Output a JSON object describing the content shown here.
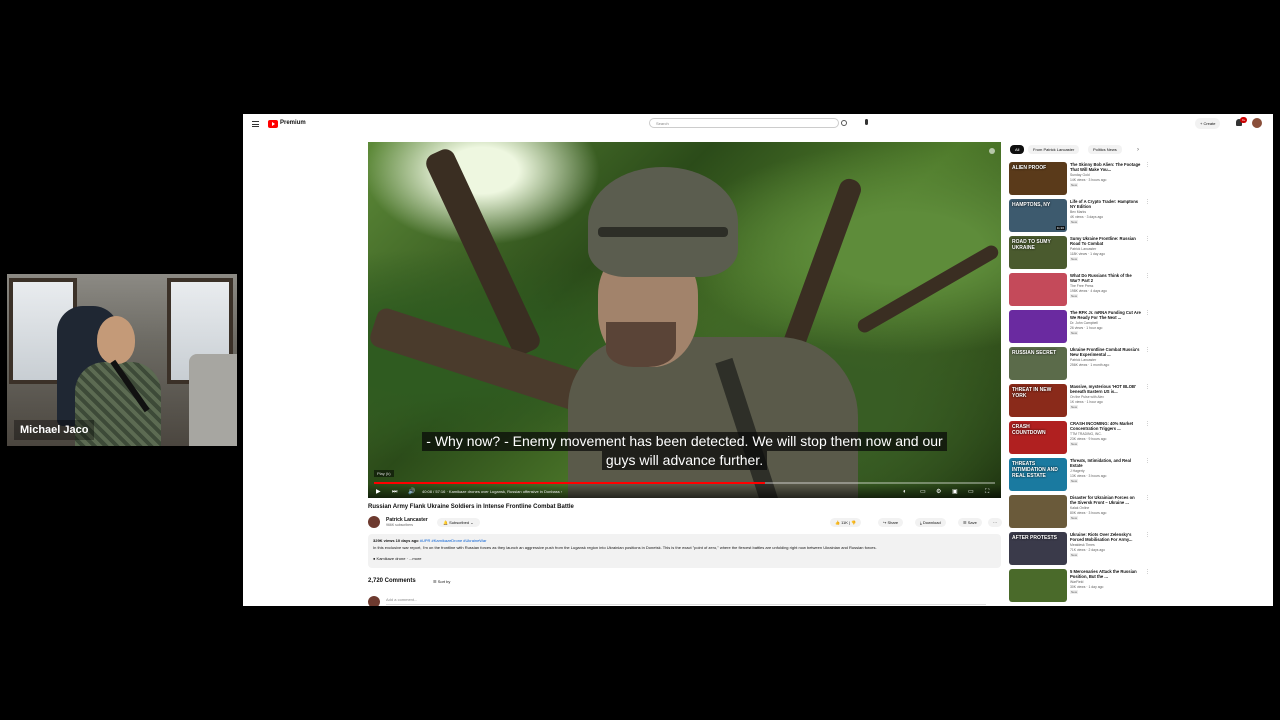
{
  "cam": {
    "name": "Michael Jaco"
  },
  "masthead": {
    "brand": "Premium",
    "search_placeholder": "Search",
    "create_label": "Create",
    "notif_count": "9+"
  },
  "player": {
    "subtitle_line1": "- Why now? - Enemy movement has been detected. We will stop them now and our",
    "subtitle_line2": "guys will advance further.",
    "chapter_label": "Play (k)",
    "time_text": "40:08 / 57:16 · Kamikaze drones over Lugansk, Russian offensive in Donbass ›",
    "progress": 0.63
  },
  "video": {
    "title": "Russian Army Flank Ukraine Soldiers in Intense Frontline Combat Battle",
    "channel": "Patrick Lancaster",
    "subscribers": "966K subscribers",
    "subscribe_label": "Subscribed",
    "likes": "11K",
    "share_label": "Share",
    "download_label": "Download",
    "save_label": "Save",
    "more_label": "···"
  },
  "description": {
    "meta": "329K views  10 days ago",
    "tags": "#UPR #KamikazeDrone #UkraineWar",
    "text": "In this exclusive war report, I'm on the frontline with Russian forces as they launch an aggressive push from the Lugansk region into Ukrainian positions in Donetsk. This is the exact \"point of zero,\" where the fiercest battles are unfolding right now between Ukrainian and Russian forces.",
    "chip": "● Kamikaze drone ·  ...more"
  },
  "comments": {
    "count": "2,720 Comments",
    "sort_label": "Sort by",
    "add_placeholder": "Add a comment..."
  },
  "chips": [
    "All",
    "From Patrick Lancaster",
    "Politics News"
  ],
  "recommendations": [
    {
      "title": "The Skinny Bob Alien: The Footage That Will Make You...",
      "channel": "Sunday Gold",
      "stats": "14K views · 3 hours ago",
      "badge": "New",
      "duration": "",
      "thumb_text": "ALIEN PROOF",
      "thumb_bg": "#5a3a1a"
    },
    {
      "title": "Life of A Crypto Trader: Hamptons NY Edition",
      "channel": "Bex Marks",
      "stats": "4K views · 3 days ago",
      "badge": "New",
      "duration": "11:36",
      "thumb_text": "HAMPTONS, NY",
      "thumb_bg": "#3d5a6e"
    },
    {
      "title": "Sumy Ukraine Frontline: Russian Road To Combat",
      "channel": "Patrick Lancaster",
      "stats": "118K views · 1 day ago",
      "badge": "New",
      "duration": "",
      "thumb_text": "ROAD TO SUMY UKRAINE",
      "thumb_bg": "#4a5a2e"
    },
    {
      "title": "What Do Russians Think of the War? Part 2",
      "channel": "The Free Press",
      "stats": "198K views · 4 days ago",
      "badge": "New",
      "duration": "",
      "thumb_text": "",
      "thumb_bg": "#c44a5a"
    },
    {
      "title": "The RFK Jr. mRNA Funding Cut Are We Ready For The Next ...",
      "channel": "Dr. John Campbell",
      "stats": "26 views · 1 hour ago",
      "badge": "New",
      "duration": "",
      "thumb_text": "",
      "thumb_bg": "#6a2aa0"
    },
    {
      "title": "Ukraine Frontline Combat Russia's New Experimental ...",
      "channel": "Patrick Lancaster",
      "stats": "256K views · 1 month ago",
      "badge": "",
      "duration": "",
      "thumb_text": "RUSSIAN SECRET",
      "thumb_bg": "#5b6b4a"
    },
    {
      "title": "Massive, mysterious 'HOT BLOB' beneath Eastern US is...",
      "channel": "On the Pulse with Alex",
      "stats": "1K views · 1 hour ago",
      "badge": "New",
      "duration": "",
      "thumb_text": "THREAT IN NEW YORK",
      "thumb_bg": "#8a2a1a"
    },
    {
      "title": "CRASH INCOMING: 40% Market Concentration Triggers ...",
      "channel": "TTM TRADING, INC.",
      "stats": "23K views · 9 hours ago",
      "badge": "New",
      "duration": "",
      "thumb_text": "CRASH COUNTDOWN",
      "thumb_bg": "#b02020"
    },
    {
      "title": "Threats, Intimidation, and Real Estate",
      "channel": "J Hagerty",
      "stats": "13K views · 3 hours ago",
      "badge": "New",
      "duration": "",
      "thumb_text": "THREATS INTIMIDATION AND REAL ESTATE",
      "thumb_bg": "#1a7aa0"
    },
    {
      "title": "Disaster for Ukrainian Forces on the Siversk Front – Ukraine ...",
      "channel": "Kalak Online",
      "stats": "80K views · 3 hours ago",
      "badge": "New",
      "duration": "",
      "thumb_text": "",
      "thumb_bg": "#6a5a3a"
    },
    {
      "title": "Ukraine: Riots Over Zelensky's Forced Mobilisation For Army...",
      "channel": "Meatdesk Times",
      "stats": "71K views · 2 days ago",
      "badge": "New",
      "duration": "",
      "thumb_text": "AFTER PROTESTS",
      "thumb_bg": "#3a3a4a"
    },
    {
      "title": "5 Mercenaries Attack the Russian Position, But the ...",
      "channel": "WarField",
      "stats": "30K views · 1 day ago",
      "badge": "New",
      "duration": "",
      "thumb_text": "",
      "thumb_bg": "#4a6a2a"
    }
  ]
}
